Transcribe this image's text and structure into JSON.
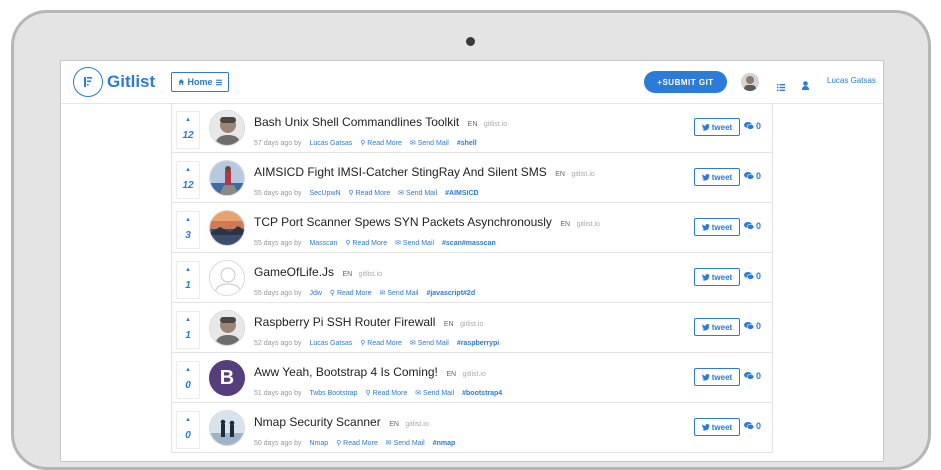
{
  "navbar": {
    "brand": "Gitlist",
    "home_label": "Home",
    "submit_label": "+SUBMIT GIT",
    "username": "Lucas Gatsas"
  },
  "colors": {
    "accent": "#2b7bd8",
    "bootstrap_purple": "#563d7c"
  },
  "items": [
    {
      "votes": "12",
      "title": "Bash Unix Shell Commandlines Toolkit",
      "lang": "EN",
      "domain": "gitlist.io",
      "age": "57 days ago by",
      "author": "Lucas Gatsas",
      "read_more": "Read More",
      "send_mail": "Send Mail",
      "tags": "#shell",
      "tweet": "tweet",
      "comments": "0",
      "thumb": "avatar-man"
    },
    {
      "votes": "12",
      "title": "AIMSICD Fight IMSI-Catcher StingRay And Silent SMS",
      "lang": "EN",
      "domain": "gitlist.io",
      "age": "55 days ago by",
      "author": "SecUpwN",
      "read_more": "Read More",
      "send_mail": "Send Mail",
      "tags": "#AIMSICD",
      "tweet": "tweet",
      "comments": "0",
      "thumb": "figure-on-rock"
    },
    {
      "votes": "3",
      "title": "TCP Port Scanner Spews SYN Packets Asynchronously",
      "lang": "EN",
      "domain": "gitlist.io",
      "age": "55 days ago by",
      "author": "Masscan",
      "read_more": "Read More",
      "send_mail": "Send Mail",
      "tags": "#scan#masscan",
      "tweet": "tweet",
      "comments": "0",
      "thumb": "sunset-landscape"
    },
    {
      "votes": "1",
      "title": "GameOfLife.Js",
      "lang": "EN",
      "domain": "gitlist.io",
      "age": "55 days ago by",
      "author": "Jdw",
      "read_more": "Read More",
      "send_mail": "Send Mail",
      "tags": "#javascript#2d",
      "tweet": "tweet",
      "comments": "0",
      "thumb": "default-user"
    },
    {
      "votes": "1",
      "title": "Raspberry Pi SSH Router Firewall",
      "lang": "EN",
      "domain": "gitlist.io",
      "age": "52 days ago by",
      "author": "Lucas Gatsas",
      "read_more": "Read More",
      "send_mail": "Send Mail",
      "tags": "#raspberrypi",
      "tweet": "tweet",
      "comments": "0",
      "thumb": "avatar-man"
    },
    {
      "votes": "0",
      "title": "Aww Yeah, Bootstrap 4 Is Coming!",
      "lang": "EN",
      "domain": "gitlist.io",
      "age": "51 days ago by",
      "author": "Twbs Bootstrap",
      "read_more": "Read More",
      "send_mail": "Send Mail",
      "tags": "#bootstrap4",
      "tweet": "tweet",
      "comments": "0",
      "thumb": "bootstrap-logo",
      "thumb_letter": "B"
    },
    {
      "votes": "0",
      "title": "Nmap Security Scanner",
      "lang": "EN",
      "domain": "gitlist.io",
      "age": "50 days ago by",
      "author": "Nmap",
      "read_more": "Read More",
      "send_mail": "Send Mail",
      "tags": "#nmap",
      "tweet": "tweet",
      "comments": "0",
      "thumb": "figures-in-field"
    }
  ]
}
